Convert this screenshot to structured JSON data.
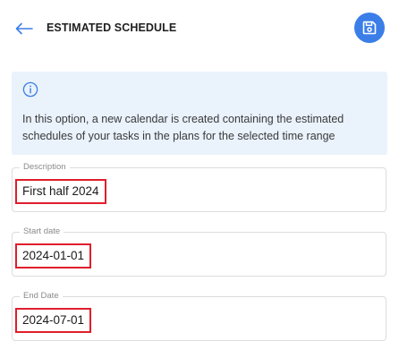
{
  "header": {
    "title": "ESTIMATED SCHEDULE",
    "back_icon": "arrow-left-icon",
    "save_icon": "save-disk-icon"
  },
  "info": {
    "icon": "info-circle-icon",
    "text": "In this option, a new calendar is created containing the estimated schedules of your tasks in the plans for the selected time range"
  },
  "fields": {
    "description": {
      "label": "Description",
      "value": "First half 2024"
    },
    "start_date": {
      "label": "Start date",
      "value": "2024-01-01"
    },
    "end_date": {
      "label": "End Date",
      "value": "2024-07-01"
    }
  },
  "colors": {
    "accent": "#3b7ee8",
    "info_background": "#eaf2fc",
    "highlight_border": "#e01e2c"
  }
}
